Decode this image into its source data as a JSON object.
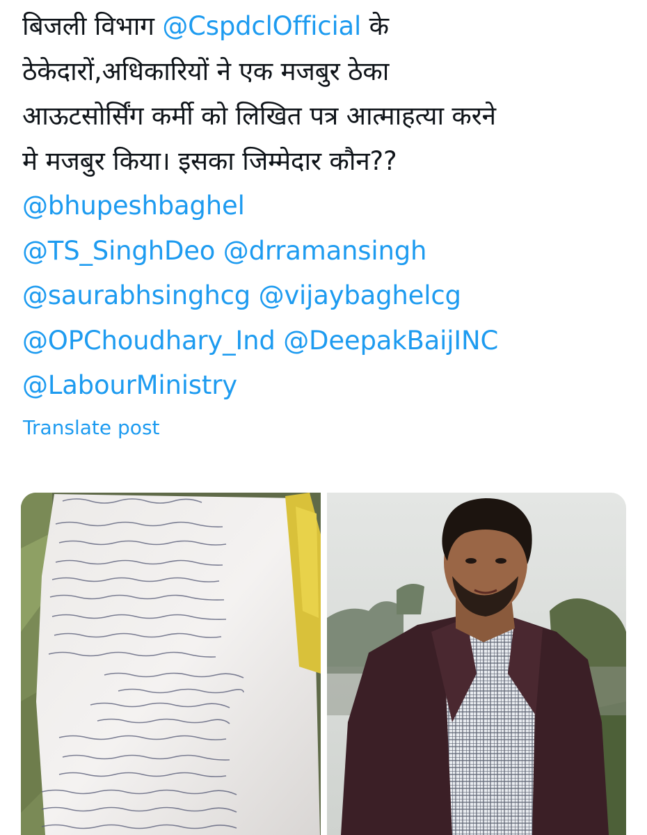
{
  "post": {
    "lines": [
      {
        "parts": [
          {
            "text": "बिजली विभाग ",
            "mention": false
          },
          {
            "text": "@CspdclOfficial",
            "mention": true
          },
          {
            "text": " के",
            "mention": false
          }
        ]
      },
      {
        "parts": [
          {
            "text": "ठेकेदारों,अधिकारियों ने एक मजबुर ठेका",
            "mention": false
          }
        ]
      },
      {
        "parts": [
          {
            "text": "आऊटसोर्सिंग कर्मी को लिखित पत्र आत्माहत्या करने",
            "mention": false
          }
        ]
      },
      {
        "parts": [
          {
            "text": "मे मजबुर किया। इसका जिम्मेदार कौन??",
            "mention": false
          }
        ]
      },
      {
        "parts": [
          {
            "text": "@bhupeshbaghel",
            "mention": true
          }
        ]
      },
      {
        "parts": [
          {
            "text": "@TS_SinghDeo",
            "mention": true
          },
          {
            "text": " ",
            "mention": false
          },
          {
            "text": "@drramansingh",
            "mention": true
          }
        ]
      },
      {
        "parts": [
          {
            "text": "@saurabhsinghcg",
            "mention": true
          },
          {
            "text": " ",
            "mention": false
          },
          {
            "text": "@vijaybaghelcg",
            "mention": true
          }
        ]
      },
      {
        "parts": [
          {
            "text": "@OPChoudhary_Ind",
            "mention": true
          },
          {
            "text": " ",
            "mention": false
          },
          {
            "text": "@DeepakBaijINC",
            "mention": true
          }
        ]
      },
      {
        "parts": [
          {
            "text": "@LabourMinistry",
            "mention": true
          }
        ]
      }
    ]
  },
  "translate_label": "Translate post",
  "media": [
    {
      "kind": "handwritten-letter-photo"
    },
    {
      "kind": "portrait-photo"
    }
  ],
  "colors": {
    "text": "#0f1419",
    "link": "#1d9bf0"
  }
}
